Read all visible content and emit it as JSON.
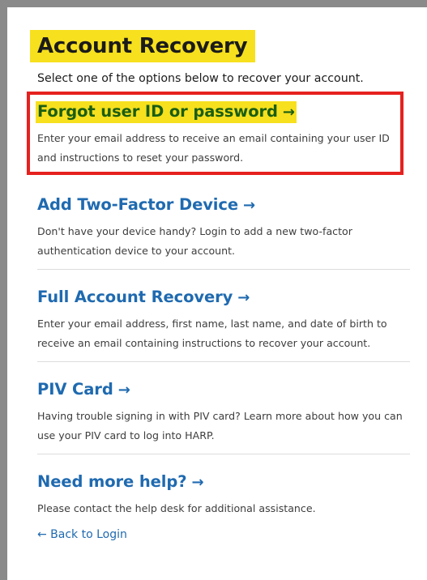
{
  "page": {
    "title": "Account Recovery",
    "intro": "Select one of the options below to recover your account."
  },
  "options": [
    {
      "label": "Forgot user ID or password",
      "description": "Enter your email address to receive an email containing your user ID and instructions to reset your password.",
      "highlighted": true
    },
    {
      "label": "Add Two-Factor Device",
      "description": "Don't have your device handy? Login to add a new two-factor authentication device to your account."
    },
    {
      "label": "Full Account Recovery",
      "description": "Enter your email address, first name, last name, and date of birth to receive an email containing instructions to recover your account."
    },
    {
      "label": "PIV Card",
      "description": "Having trouble signing in with PIV card? Learn more about how you can use your PIV card to log into HARP."
    },
    {
      "label": "Need more help?",
      "description": "Please contact the help desk for additional assistance."
    }
  ],
  "arrow_glyph": "→",
  "back": {
    "label": "← Back to Login"
  },
  "colors": {
    "highlight": "#f7e01e",
    "link": "#1f6ab0",
    "highlight_text": "#1a5e12",
    "annotation_box": "#e5211e",
    "frame": "#8a8a8a"
  },
  "icons": {
    "forward": "arrow-right-icon",
    "back": "arrow-left-icon"
  }
}
